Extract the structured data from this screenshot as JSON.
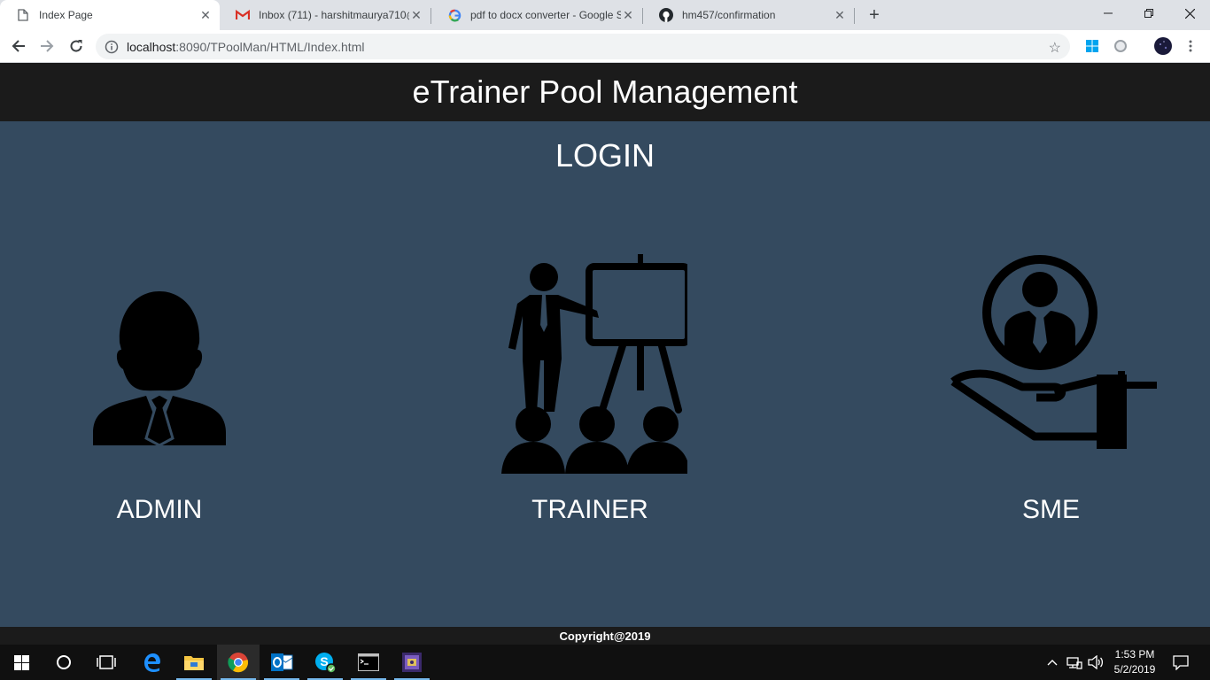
{
  "browser": {
    "tabs": [
      {
        "title": "Index Page",
        "icon": "document-icon",
        "active": true
      },
      {
        "title": "Inbox (711) - harshitmaurya710@",
        "icon": "gmail-icon",
        "active": false
      },
      {
        "title": "pdf to docx converter - Google S",
        "icon": "google-icon",
        "active": false
      },
      {
        "title": "hm457/confirmation",
        "icon": "github-icon",
        "active": false
      }
    ],
    "new_tab": "+",
    "address": {
      "host": "localhost",
      "path": ":8090/TPoolMan/HTML/Index.html"
    }
  },
  "page": {
    "header": "eTrainer Pool Management",
    "login_title": "LOGIN",
    "roles": [
      {
        "label": "ADMIN",
        "icon": "admin-person-icon"
      },
      {
        "label": "TRAINER",
        "icon": "trainer-presentation-icon"
      },
      {
        "label": "SME",
        "icon": "sme-hand-person-icon"
      }
    ],
    "footer": "Copyright@2019"
  },
  "taskbar": {
    "clock_time": "1:53 PM",
    "clock_date": "5/2/2019"
  },
  "colors": {
    "page_bg": "#344a5f",
    "header_bg": "#1b1b1b",
    "tabstrip_bg": "#dee1e6",
    "taskbar_bg": "#101010"
  }
}
